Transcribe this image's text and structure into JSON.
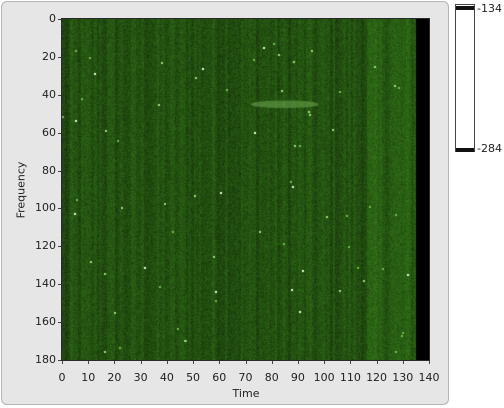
{
  "chart_data": {
    "type": "heatmap",
    "title": "",
    "xlabel": "Time",
    "ylabel": "Frequency",
    "xlim": [
      0,
      140
    ],
    "ylim": [
      0,
      180
    ],
    "y_inverted": true,
    "x_ticks": [
      "0",
      "10",
      "20",
      "30",
      "40",
      "50",
      "60",
      "70",
      "80",
      "90",
      "100",
      "110",
      "120",
      "130",
      "140"
    ],
    "y_ticks": [
      "0",
      "20",
      "40",
      "60",
      "80",
      "100",
      "120",
      "140",
      "160",
      "180"
    ],
    "colormap": [
      "#1f3a10",
      "#3d7a22",
      "#ffffff"
    ],
    "data_extent_x": [
      0,
      135
    ],
    "empty_region_color": "#000000",
    "color_scale": {
      "max_label": "-134",
      "min_label": "-284",
      "max": -134,
      "min": -284,
      "high_color": "#ffffff",
      "low_color": "#000000"
    },
    "features": [
      {
        "kind": "streak",
        "x": [
          72,
          98
        ],
        "y": [
          44,
          46
        ]
      }
    ]
  }
}
